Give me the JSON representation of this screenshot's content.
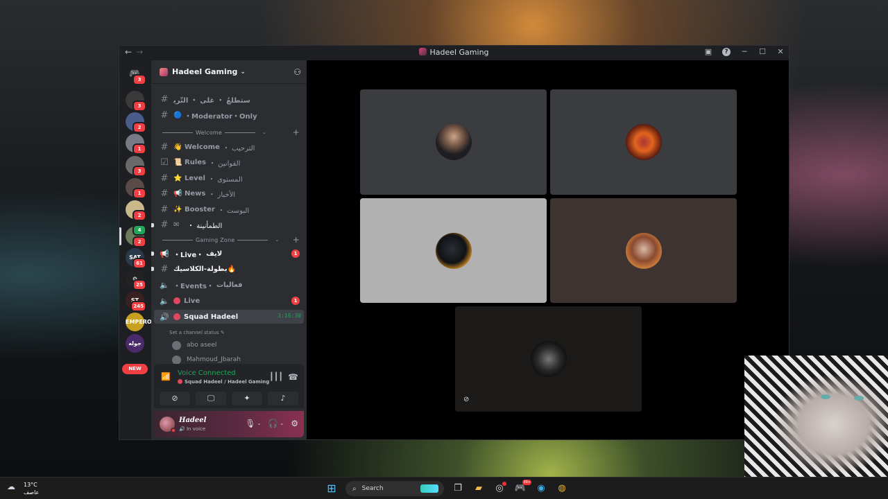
{
  "window": {
    "title": "Hadeel Gaming",
    "nav_back": "←",
    "nav_forward": "→",
    "help": "?",
    "minimize": "─",
    "maximize": "☐",
    "close": "✕"
  },
  "server": {
    "name": "Hadeel Gaming"
  },
  "rail": {
    "home_badge": "3",
    "items": [
      {
        "badge": "3",
        "color": "#3a3a3a"
      },
      {
        "badge": "2",
        "color": "#4a5c8a"
      },
      {
        "badge": "1",
        "color": "#7a7a86"
      },
      {
        "badge": "3",
        "color": "#6a6a6a"
      },
      {
        "badge": "1",
        "color": "#5a4a48"
      },
      {
        "badge": "2",
        "color": "#c8b88a"
      },
      {
        "badge": "2",
        "color": "#6a7a5a",
        "top_badge": "4"
      },
      {
        "badge": "61",
        "color": "#2a3a4a",
        "text": "SAT"
      },
      {
        "badge": "25",
        "color": "#222",
        "text": "⚙"
      },
      {
        "badge": "245",
        "color": "#3a2020",
        "text": "ST"
      },
      {
        "badge": "",
        "color": "#c8a020",
        "text": "EMPEROR"
      },
      {
        "badge": "",
        "color": "#4a2a6a",
        "text": "جوله"
      }
    ],
    "new_label": "NEW"
  },
  "channels": {
    "top": [
      {
        "name": "ﺳﺘﻄﻠﻊُ ・ ﻏﻠﻰ ・ ﺍﻟﺘّﺮﻳ",
        "emoji": ""
      },
      {
        "name": "・Moderator・Only",
        "emoji": "🔵"
      }
    ],
    "welcome_category": "Welcome",
    "welcome": [
      {
        "emoji": "👋",
        "name": "Welcome",
        "ar": "・ الترحيب"
      },
      {
        "emoji": "📜",
        "name": "Rules",
        "ar": "・ القوانين"
      },
      {
        "emoji": "⭐",
        "name": "Level",
        "ar": "・ المستوى"
      },
      {
        "emoji": "📢",
        "name": "News",
        "ar": "・ الأخبار"
      },
      {
        "emoji": "✨",
        "name": "Booster",
        "ar": "・ البوست"
      },
      {
        "emoji": "✉",
        "name": "",
        "ar": "・ الطمأنينة"
      }
    ],
    "gaming_category": "Gaming Zone",
    "gaming": [
      {
        "name": "・Live・",
        "ar": "لايف",
        "badge": "1"
      },
      {
        "name": "",
        "ar": "بطولة-الكلاسيك🔥",
        "badge": ""
      },
      {
        "name": "・Events・",
        "ar": "فعاليات",
        "badge": ""
      },
      {
        "name": "Live",
        "ar": "",
        "badge": "1"
      },
      {
        "name": "Squad Hadeel",
        "ar": "",
        "badge": "",
        "timer": "3:16:30"
      }
    ],
    "channel_status": "Set a channel status",
    "members": [
      "abo aseel",
      "Mahmoud_Jbarah"
    ]
  },
  "voice": {
    "title": "Voice Connected",
    "subtitle": "Squad Hadeel / Hadeel Gaming"
  },
  "user": {
    "name": "Hadeel",
    "status": "In voice"
  },
  "tiles": [
    {
      "bg": "#3b3c40"
    },
    {
      "bg": "#3b3c40"
    },
    {
      "bg": "#b1b1b1"
    },
    {
      "bg": "#3d3431"
    },
    {
      "bg": "#1b1a19"
    }
  ],
  "taskbar": {
    "temperature": "13°C",
    "weather_desc": "عاصف",
    "search_placeholder": "Search",
    "discord_badge": "99+"
  }
}
